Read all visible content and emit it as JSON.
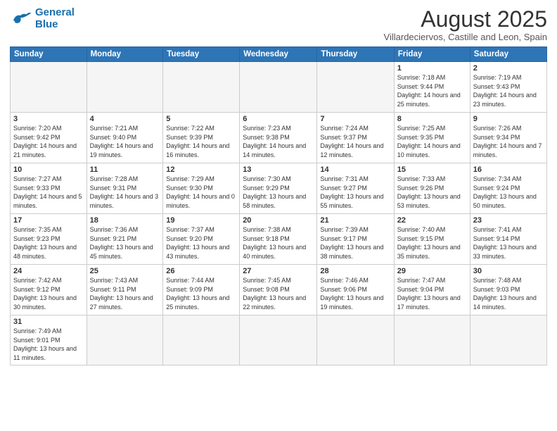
{
  "logo": {
    "line1": "General",
    "line2": "Blue"
  },
  "title": "August 2025",
  "subtitle": "Villardeciervos, Castille and Leon, Spain",
  "days_of_week": [
    "Sunday",
    "Monday",
    "Tuesday",
    "Wednesday",
    "Thursday",
    "Friday",
    "Saturday"
  ],
  "weeks": [
    [
      {
        "day": "",
        "info": ""
      },
      {
        "day": "",
        "info": ""
      },
      {
        "day": "",
        "info": ""
      },
      {
        "day": "",
        "info": ""
      },
      {
        "day": "",
        "info": ""
      },
      {
        "day": "1",
        "info": "Sunrise: 7:18 AM\nSunset: 9:44 PM\nDaylight: 14 hours and 25 minutes."
      },
      {
        "day": "2",
        "info": "Sunrise: 7:19 AM\nSunset: 9:43 PM\nDaylight: 14 hours and 23 minutes."
      }
    ],
    [
      {
        "day": "3",
        "info": "Sunrise: 7:20 AM\nSunset: 9:42 PM\nDaylight: 14 hours and 21 minutes."
      },
      {
        "day": "4",
        "info": "Sunrise: 7:21 AM\nSunset: 9:40 PM\nDaylight: 14 hours and 19 minutes."
      },
      {
        "day": "5",
        "info": "Sunrise: 7:22 AM\nSunset: 9:39 PM\nDaylight: 14 hours and 16 minutes."
      },
      {
        "day": "6",
        "info": "Sunrise: 7:23 AM\nSunset: 9:38 PM\nDaylight: 14 hours and 14 minutes."
      },
      {
        "day": "7",
        "info": "Sunrise: 7:24 AM\nSunset: 9:37 PM\nDaylight: 14 hours and 12 minutes."
      },
      {
        "day": "8",
        "info": "Sunrise: 7:25 AM\nSunset: 9:35 PM\nDaylight: 14 hours and 10 minutes."
      },
      {
        "day": "9",
        "info": "Sunrise: 7:26 AM\nSunset: 9:34 PM\nDaylight: 14 hours and 7 minutes."
      }
    ],
    [
      {
        "day": "10",
        "info": "Sunrise: 7:27 AM\nSunset: 9:33 PM\nDaylight: 14 hours and 5 minutes."
      },
      {
        "day": "11",
        "info": "Sunrise: 7:28 AM\nSunset: 9:31 PM\nDaylight: 14 hours and 3 minutes."
      },
      {
        "day": "12",
        "info": "Sunrise: 7:29 AM\nSunset: 9:30 PM\nDaylight: 14 hours and 0 minutes."
      },
      {
        "day": "13",
        "info": "Sunrise: 7:30 AM\nSunset: 9:29 PM\nDaylight: 13 hours and 58 minutes."
      },
      {
        "day": "14",
        "info": "Sunrise: 7:31 AM\nSunset: 9:27 PM\nDaylight: 13 hours and 55 minutes."
      },
      {
        "day": "15",
        "info": "Sunrise: 7:33 AM\nSunset: 9:26 PM\nDaylight: 13 hours and 53 minutes."
      },
      {
        "day": "16",
        "info": "Sunrise: 7:34 AM\nSunset: 9:24 PM\nDaylight: 13 hours and 50 minutes."
      }
    ],
    [
      {
        "day": "17",
        "info": "Sunrise: 7:35 AM\nSunset: 9:23 PM\nDaylight: 13 hours and 48 minutes."
      },
      {
        "day": "18",
        "info": "Sunrise: 7:36 AM\nSunset: 9:21 PM\nDaylight: 13 hours and 45 minutes."
      },
      {
        "day": "19",
        "info": "Sunrise: 7:37 AM\nSunset: 9:20 PM\nDaylight: 13 hours and 43 minutes."
      },
      {
        "day": "20",
        "info": "Sunrise: 7:38 AM\nSunset: 9:18 PM\nDaylight: 13 hours and 40 minutes."
      },
      {
        "day": "21",
        "info": "Sunrise: 7:39 AM\nSunset: 9:17 PM\nDaylight: 13 hours and 38 minutes."
      },
      {
        "day": "22",
        "info": "Sunrise: 7:40 AM\nSunset: 9:15 PM\nDaylight: 13 hours and 35 minutes."
      },
      {
        "day": "23",
        "info": "Sunrise: 7:41 AM\nSunset: 9:14 PM\nDaylight: 13 hours and 33 minutes."
      }
    ],
    [
      {
        "day": "24",
        "info": "Sunrise: 7:42 AM\nSunset: 9:12 PM\nDaylight: 13 hours and 30 minutes."
      },
      {
        "day": "25",
        "info": "Sunrise: 7:43 AM\nSunset: 9:11 PM\nDaylight: 13 hours and 27 minutes."
      },
      {
        "day": "26",
        "info": "Sunrise: 7:44 AM\nSunset: 9:09 PM\nDaylight: 13 hours and 25 minutes."
      },
      {
        "day": "27",
        "info": "Sunrise: 7:45 AM\nSunset: 9:08 PM\nDaylight: 13 hours and 22 minutes."
      },
      {
        "day": "28",
        "info": "Sunrise: 7:46 AM\nSunset: 9:06 PM\nDaylight: 13 hours and 19 minutes."
      },
      {
        "day": "29",
        "info": "Sunrise: 7:47 AM\nSunset: 9:04 PM\nDaylight: 13 hours and 17 minutes."
      },
      {
        "day": "30",
        "info": "Sunrise: 7:48 AM\nSunset: 9:03 PM\nDaylight: 13 hours and 14 minutes."
      }
    ],
    [
      {
        "day": "31",
        "info": "Sunrise: 7:49 AM\nSunset: 9:01 PM\nDaylight: 13 hours and 11 minutes."
      },
      {
        "day": "",
        "info": ""
      },
      {
        "day": "",
        "info": ""
      },
      {
        "day": "",
        "info": ""
      },
      {
        "day": "",
        "info": ""
      },
      {
        "day": "",
        "info": ""
      },
      {
        "day": "",
        "info": ""
      }
    ]
  ]
}
